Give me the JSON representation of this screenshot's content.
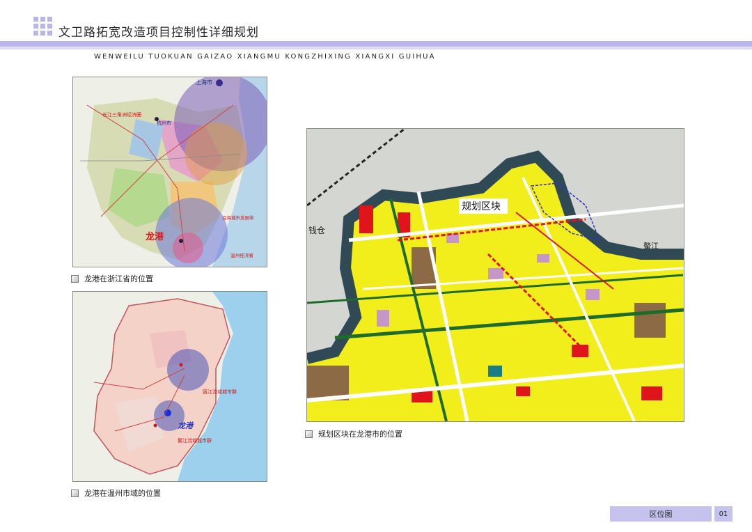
{
  "header": {
    "title": "文卫路拓宽改造项目控制性详细规划",
    "subtitle": "WENWEILU TUOKUAN GAIZAO XIANGMU KONGZHIXING XIANGXI GUIHUA"
  },
  "maps": {
    "zhejiang": {
      "caption": "龙港在浙江省的位置",
      "labels": {
        "shanghai": "上海市",
        "yangtze_delta": "长江三角洲经济圈",
        "hangzhou": "杭州市",
        "coastal_belt": "沿海城市发展带",
        "wenzhou_circle": "温州经济圈",
        "longgang": "龙港"
      }
    },
    "wenzhou": {
      "caption": "龙港在温州市域的位置",
      "labels": {
        "ou_river": "瓯江流域城市群",
        "ao_river": "鳌江流域城市群",
        "longgang": "龙港"
      }
    },
    "city": {
      "caption": "规划区块在龙港市的位置",
      "labels": {
        "plan_block": "规划区块",
        "qiancang": "钱仓",
        "aojiang": "鳌江"
      }
    }
  },
  "footer": {
    "label": "区位图",
    "page": "01"
  },
  "colors": {
    "accent": "#b8b6ea",
    "footer_bg": "#c5c3ee",
    "map_yellow": "#f2ee1c",
    "map_red": "#e0151b",
    "map_green": "#1f6b2a",
    "river": "#2f4a55"
  }
}
